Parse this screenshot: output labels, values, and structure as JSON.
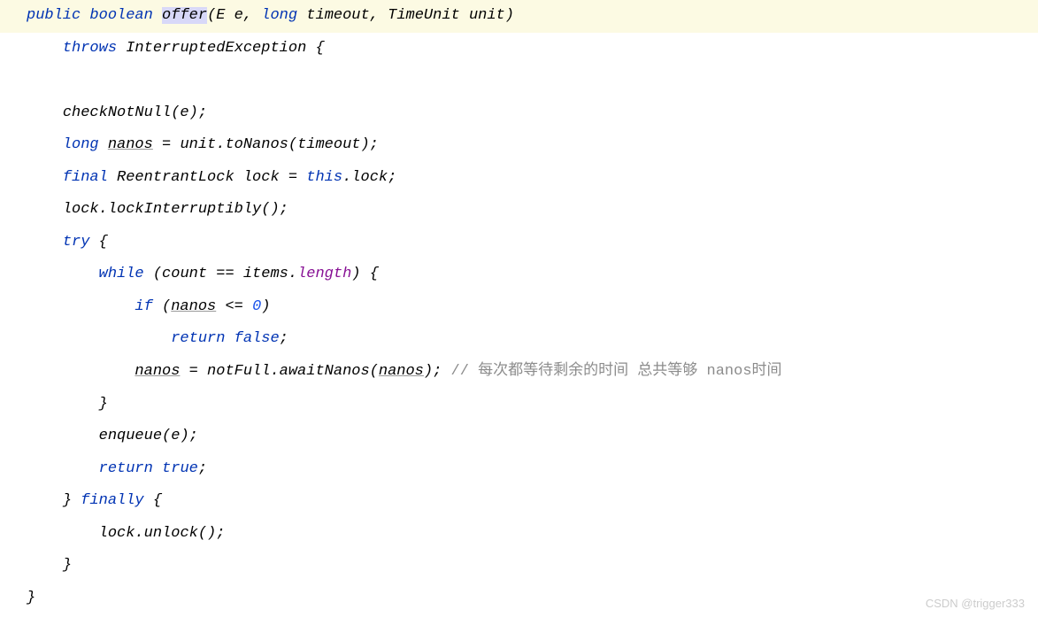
{
  "code": {
    "l1": {
      "kw1": "public",
      "kw2": "boolean",
      "method": "offer",
      "p1": "E e",
      "p2type": "long",
      "p2name": "timeout",
      "p3": "TimeUnit unit)"
    },
    "l2": {
      "kw": "throws",
      "exc": "InterruptedException {"
    },
    "l3": {
      "call": "checkNotNull(e);"
    },
    "l4": {
      "kw": "long",
      "var": "nanos",
      "rest": " = unit.toNanos(timeout);"
    },
    "l5": {
      "kw1": "final",
      "type": "ReentrantLock lock = ",
      "kw2": "this",
      "rest": ".lock;"
    },
    "l6": {
      "call": "lock.lockInterruptibly();"
    },
    "l7": {
      "kw": "try",
      "rest": " {"
    },
    "l8": {
      "kw": "while",
      "rest1": " (count == items.",
      "field": "length",
      "rest2": ") {"
    },
    "l9": {
      "kw": "if",
      "rest1": " (",
      "var": "nanos",
      "rest2": " <= ",
      "num": "0",
      "rest3": ")"
    },
    "l10": {
      "kw1": "return",
      "kw2": "false",
      "rest": ";"
    },
    "l11": {
      "var1": "nanos",
      "rest1": " = notFull.awaitNanos(",
      "var2": "nanos",
      "rest2": "); ",
      "comment": "// 每次都等待剩余的时间 总共等够 nanos时间"
    },
    "l12": "}",
    "l13": "enqueue(e);",
    "l14": {
      "kw1": "return",
      "kw2": "true",
      "rest": ";"
    },
    "l15": {
      "rest1": "} ",
      "kw": "finally",
      "rest2": " {"
    },
    "l16": "lock.unlock();",
    "l17": "}",
    "l18": "}"
  },
  "watermark": "CSDN @trigger333"
}
